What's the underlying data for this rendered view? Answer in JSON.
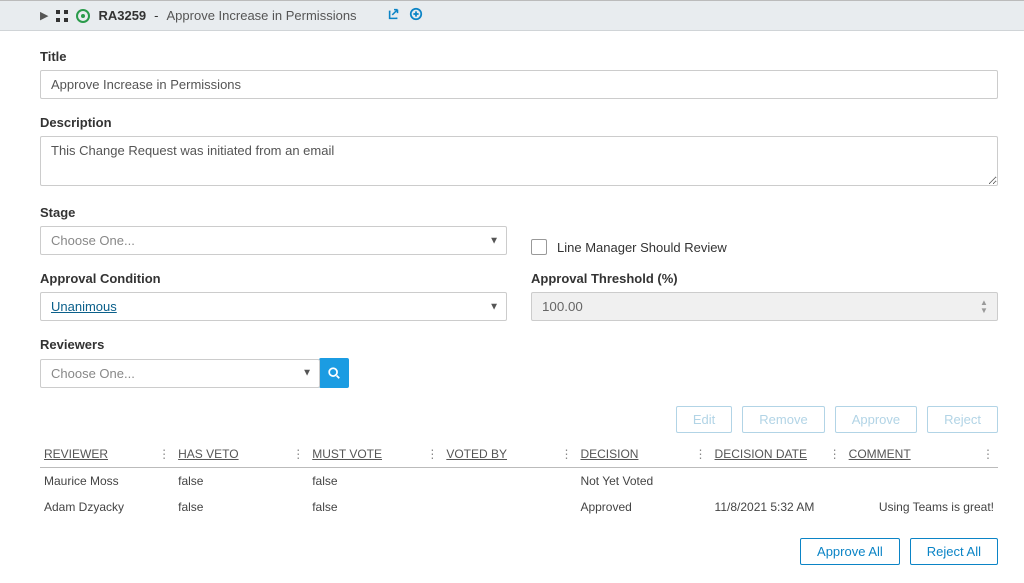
{
  "header": {
    "record_id": "RA3259",
    "record_title": "Approve Increase in Permissions"
  },
  "fields": {
    "title_label": "Title",
    "title_value": "Approve Increase in Permissions",
    "description_label": "Description",
    "description_value": "This Change Request was initiated from an email",
    "stage_label": "Stage",
    "stage_placeholder": "Choose One...",
    "line_manager_label": "Line Manager Should Review",
    "approval_condition_label": "Approval Condition",
    "approval_condition_value": "Unanimous",
    "approval_threshold_label": "Approval Threshold (%)",
    "approval_threshold_value": "100.00",
    "reviewers_label": "Reviewers",
    "reviewers_placeholder": "Choose One..."
  },
  "actions": {
    "edit": "Edit",
    "remove": "Remove",
    "approve": "Approve",
    "reject": "Reject",
    "approve_all": "Approve All",
    "reject_all": "Reject All"
  },
  "table": {
    "columns": {
      "reviewer": "REVIEWER",
      "has_veto": "HAS VETO",
      "must_vote": "MUST VOTE",
      "voted_by": "VOTED BY",
      "decision": "DECISION",
      "decision_date": "DECISION DATE",
      "comment": "COMMENT"
    },
    "rows": [
      {
        "reviewer": "Maurice Moss",
        "has_veto": "false",
        "must_vote": "false",
        "voted_by": "",
        "decision": "Not Yet Voted",
        "decision_date": "",
        "comment": ""
      },
      {
        "reviewer": "Adam Dzyacky",
        "has_veto": "false",
        "must_vote": "false",
        "voted_by": "",
        "decision": "Approved",
        "decision_date": "11/8/2021 5:32 AM",
        "comment": "Using Teams is great!"
      }
    ]
  }
}
